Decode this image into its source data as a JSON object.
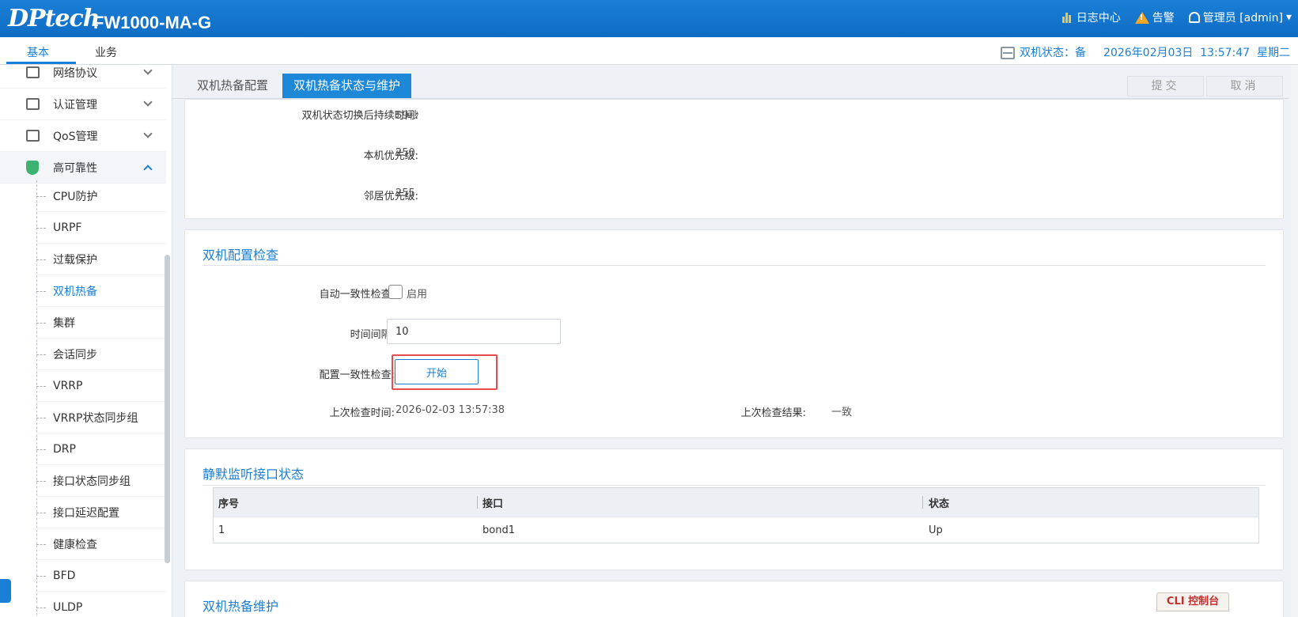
{
  "header": {
    "brand": "DPtech",
    "model": "FW1000-MA-G",
    "log_center": "日志中心",
    "alarm": "告警",
    "user": "管理员 [admin]",
    "user_chevron": "▾"
  },
  "nav": {
    "tabs": [
      "基本",
      "业务"
    ],
    "ha_status": "双机状态：备",
    "date": "2026年02月03日",
    "time": "13:57:47",
    "weekday": "星期二"
  },
  "sidebar": {
    "groups": [
      "网络协议",
      "认证管理",
      "QoS管理",
      "高可靠性"
    ],
    "items": [
      "CPU防护",
      "URPF",
      "过载保护",
      "双机热备",
      "集群",
      "会话同步",
      "VRRP",
      "VRRP状态同步组",
      "DRP",
      "接口状态同步组",
      "接口延迟配置",
      "健康检查",
      "BFD",
      "ULDP"
    ]
  },
  "main": {
    "tabs": [
      "双机热备配置",
      "双机热备状态与维护"
    ],
    "submit": "提交",
    "cancel": "取消"
  },
  "status": {
    "switch_duration_label": "双机状态切换后持续时间:",
    "switch_duration_value": "59秒",
    "local_priority_label": "本机优先级:",
    "local_priority_value": "250",
    "neighbor_priority_label": "邻居优先级:",
    "neighbor_priority_value": "255"
  },
  "config_check": {
    "title": "双机配置检查",
    "auto_label": "自动一致性检查:",
    "auto_option": "启用",
    "auto_enabled": false,
    "interval_label": "时间间隔:",
    "interval_value": "10",
    "consistency_label": "配置一致性检查:",
    "start_button": "开始",
    "last_time_label": "上次检查时间:",
    "last_time_value": "2026-02-03 13:57:38",
    "last_result_label": "上次检查结果:",
    "last_result_value": "一致"
  },
  "silent_monitor": {
    "title": "静默监听接口状态",
    "columns": [
      "序号",
      "接口",
      "状态"
    ],
    "rows": [
      [
        "1",
        "bond1",
        "Up"
      ]
    ]
  },
  "maintenance": {
    "title": "双机热备维护"
  },
  "cli": {
    "label": "CLI 控制台"
  },
  "colors": {
    "primary": "#1a7fd6",
    "header": "#1276cf",
    "highlight": "#e84b4b"
  }
}
